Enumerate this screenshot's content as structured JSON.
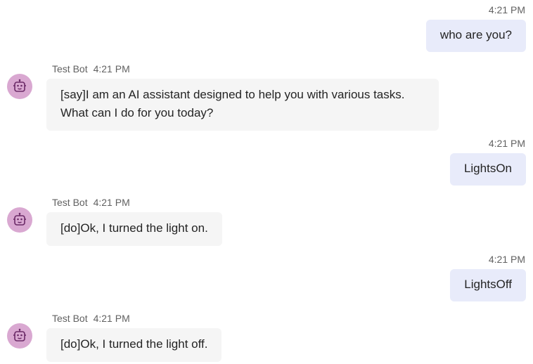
{
  "messages": [
    {
      "type": "user",
      "time": "4:21 PM",
      "text": "who are you?"
    },
    {
      "type": "bot",
      "sender": "Test Bot",
      "time": "4:21 PM",
      "text": "[say]I am an AI assistant designed to help you with various tasks. What can I do for you today?"
    },
    {
      "type": "user",
      "time": "4:21 PM",
      "text": "LightsOn"
    },
    {
      "type": "bot",
      "sender": "Test Bot",
      "time": "4:21 PM",
      "text": "[do]Ok, I turned the light on."
    },
    {
      "type": "user",
      "time": "4:21 PM",
      "text": "LightsOff"
    },
    {
      "type": "bot",
      "sender": "Test Bot",
      "time": "4:21 PM",
      "text": "[do]Ok, I turned the light off."
    }
  ],
  "colors": {
    "user_bubble": "#e8ebfa",
    "bot_bubble": "#f5f5f5",
    "avatar_bg": "#d9a8d1",
    "avatar_icon": "#6b2a67"
  },
  "icons": {
    "bot_avatar": "robot-icon"
  }
}
